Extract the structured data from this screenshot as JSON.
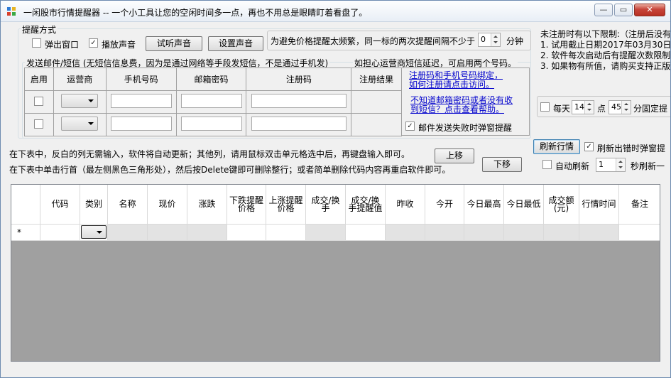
{
  "window": {
    "title": "一闲股市行情提醒器 -- 一个小工具让您的空闲时间多一点，再也不用总是眼睛盯着看盘了。",
    "min": "—",
    "max": "▭",
    "close": "✕"
  },
  "alert": {
    "group_label": "提醒方式",
    "popup_label": "弹出窗口",
    "popup_checked": false,
    "sound_label": "播放声音",
    "sound_checked": true,
    "test_sound_btn": "试听声音",
    "set_sound_btn": "设置声音"
  },
  "interval": {
    "label": "为避免价格提醒太频繁，同一标的两次提醒间隔不少于",
    "value": "0",
    "unit": "分钟"
  },
  "notice": {
    "line1": "未注册时有以下限制:（注册后没有",
    "line2": "1. 试用截止日期2017年03月30日",
    "line3": "2. 软件每次启动后有提醒次数限制",
    "line4": "3. 如果物有所值，请购买支持正版"
  },
  "daily": {
    "label": "每天",
    "hour": "14",
    "point_label": "点",
    "minute": "45",
    "suffix": "分固定提"
  },
  "sms": {
    "group_label": "发送邮件/短信 (无短信信息费，因为是通过网络等手段发短信，不是通过手机发)",
    "note": "如担心运营商短信延迟，可启用两个号码。",
    "headers": [
      "启用",
      "运营商",
      "手机号码",
      "邮箱密码",
      "注册码",
      "注册结果"
    ],
    "rows": [
      {
        "enabled": false,
        "carrier": "",
        "phone": "",
        "password": "",
        "regcode": "",
        "result": ""
      },
      {
        "enabled": false,
        "carrier": "",
        "phone": "",
        "password": "",
        "regcode": "",
        "result": ""
      }
    ],
    "link1": "注册码和手机号码绑定，如何注册请点击访问。",
    "link2": "不知道邮箱密码或者没有收到短信？点击查看帮助。",
    "fail_popup_label": "邮件发送失败时弹窗提醒",
    "fail_popup_checked": true
  },
  "help": {
    "line1": "在下表中，反白的列无需输入，软件将自动更新；其他列，请用鼠标双击单元格选中后，再键盘输入即可。",
    "line2": "在下表中单击行首（最左侧黑色三角形处），然后按Delete键即可删除整行；或者简单删除代码内容再重启软件即可。"
  },
  "buttons": {
    "up": "上移",
    "down": "下移",
    "refresh": "刷新行情"
  },
  "refresh": {
    "error_popup_label": "刷新出错时弹窗提",
    "error_popup_checked": true,
    "auto_label": "自动刷新",
    "auto_checked": false,
    "seconds": "1",
    "seconds_label": "秒刷新一"
  },
  "grid": {
    "columns": [
      "代码",
      "类别",
      "名称",
      "现价",
      "涨跌",
      "下跌提醒价格",
      "上涨提醒价格",
      "成交/换手",
      "成交/换手提醒值",
      "昨收",
      "今开",
      "今日最高",
      "今日最低",
      "成交额(元)",
      "行情时间",
      "备注"
    ],
    "new_row_marker": "*"
  }
}
